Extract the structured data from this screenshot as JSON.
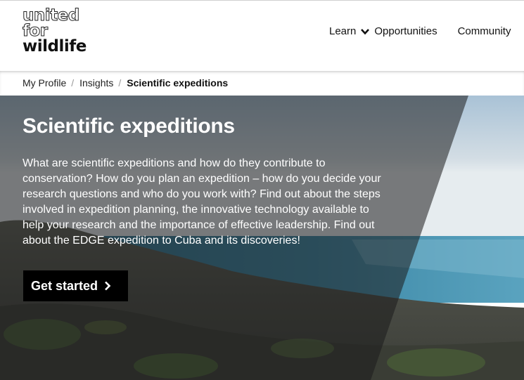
{
  "brand": {
    "logo_line1": "united",
    "logo_line2": "for",
    "logo_line3": "wildlife"
  },
  "nav": {
    "learn_label": "Learn",
    "learn_icon": "chevron-down-icon",
    "opportunities_label": "Opportunities",
    "community_label": "Community"
  },
  "breadcrumb": {
    "items": [
      "My Profile",
      "Insights"
    ],
    "separator": "/",
    "current": "Scientific expeditions"
  },
  "hero": {
    "title": "Scientific expeditions",
    "description": "What are scientific expeditions and how do they contribute to conservation? How do you plan an expedition – how do you decide your research questions and who do you work with? Find out about the steps involved in expedition planning, the innovative technology available to help your research and the importance of effective leadership. Find out about the EDGE expedition to Cuba and its discoveries!",
    "cta_label": "Get started",
    "cta_icon": "chevron-right-icon"
  }
}
